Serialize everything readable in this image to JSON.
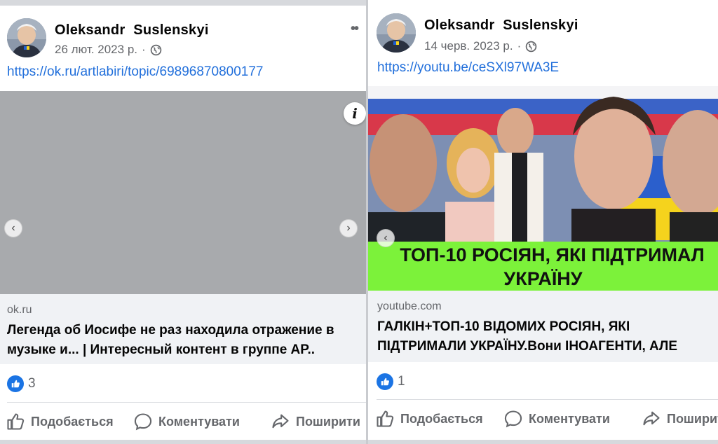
{
  "posts": [
    {
      "author": "Oleksandr  Suslenskyi",
      "date": "26 лют. 2023 р.",
      "link_url": "https://ok.ru/artlabiri/topic/69896870800177",
      "source_domain": "ok.ru",
      "source_title": "Легенда об Иосифе не раз находила отражение в музыке и... | Интересный контент в группе AP..",
      "reaction_count": "3",
      "actions": {
        "like": "Подобається",
        "comment": "Коментувати",
        "share": "Поширити"
      },
      "media_color": "#a8aaad"
    },
    {
      "author": "Oleksandr  Suslenskyi",
      "date": "14 черв. 2023 р.",
      "link_url": "https://youtu.be/ceSXl97WA3E",
      "banner_line1": "ТОП-10 РОСІЯН, ЯКІ ПІДТРИМАЛ",
      "banner_line2": "УКРАЇНУ",
      "source_domain": "youtube.com",
      "source_title_line1": "ГАЛКІН+ТОП-10 ВІДОМИХ РОСІЯН, ЯКІ",
      "source_title_line2": "ПІДТРИМАЛИ УКРАЇНУ.Вони ІНОАГЕНТИ, АЛЕ",
      "reaction_count": "1",
      "actions": {
        "like": "Подобається",
        "comment": "Коментувати",
        "share": "Поширити"
      },
      "banner_color": "#7cf23a"
    }
  ],
  "icons": {
    "privacy": "globe-icon",
    "more": "more-options-icon",
    "info": "info-icon",
    "prev": "chevron-left-icon",
    "next": "chevron-right-icon",
    "like": "thumbs-up-icon",
    "comment": "comment-bubble-icon",
    "share": "share-arrow-icon"
  },
  "colors": {
    "link": "#216fdb",
    "like_badge": "#1b74e4",
    "secondary_text": "#65676b",
    "source_bg": "#f0f2f5"
  }
}
